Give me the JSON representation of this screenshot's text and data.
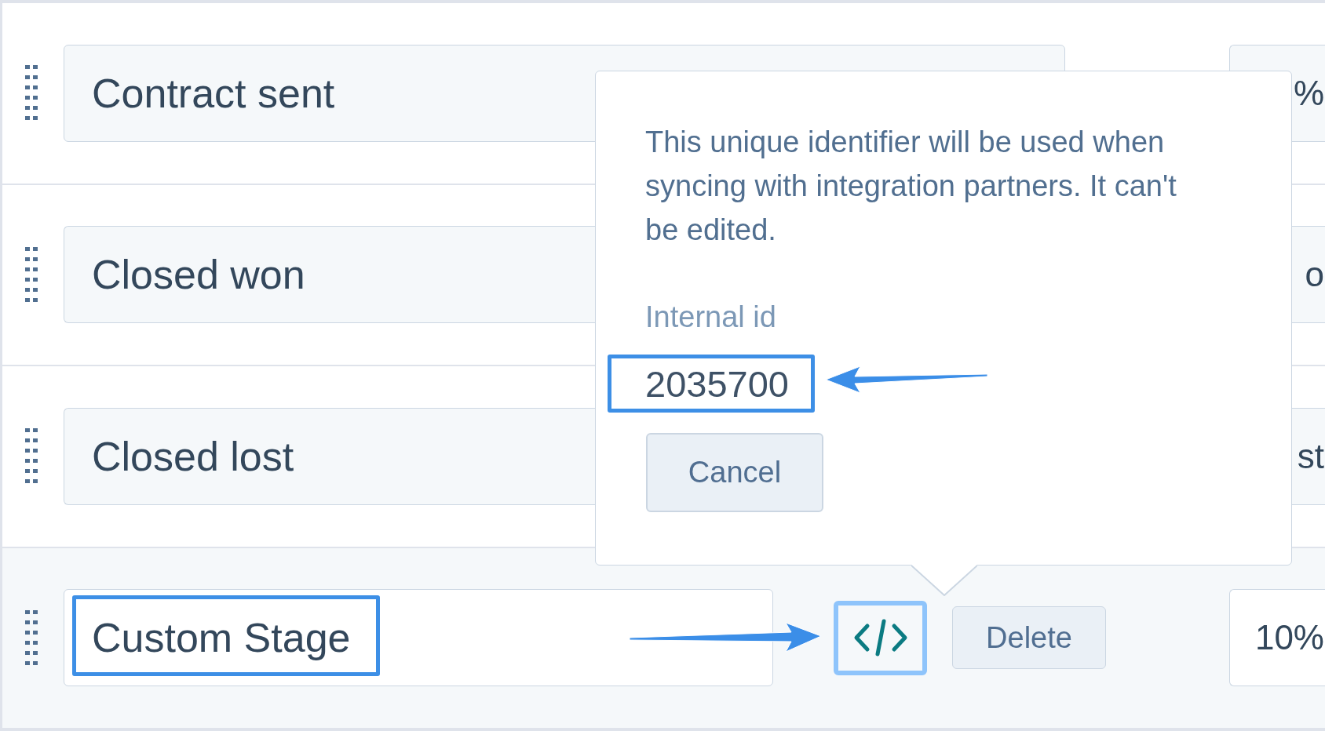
{
  "stages": [
    {
      "name": "Contract sent",
      "column_2": "%",
      "highlighted": false
    },
    {
      "name": "Closed won",
      "column_2": "o",
      "highlighted": false
    },
    {
      "name": "Closed lost",
      "column_2": "st",
      "highlighted": false
    },
    {
      "name": "Custom Stage",
      "column_2": "10%",
      "highlighted": true,
      "actions": [
        {
          "kind": "code",
          "focused": true
        },
        {
          "kind": "delete",
          "label": "Delete",
          "focused": false
        }
      ]
    }
  ],
  "popover": {
    "text": "This unique identifier will be used when syncing with integration partners. It can't be edited.",
    "field_label": "Internal id",
    "field_value": "2035700",
    "value_highlighted": true,
    "button": "Cancel"
  }
}
